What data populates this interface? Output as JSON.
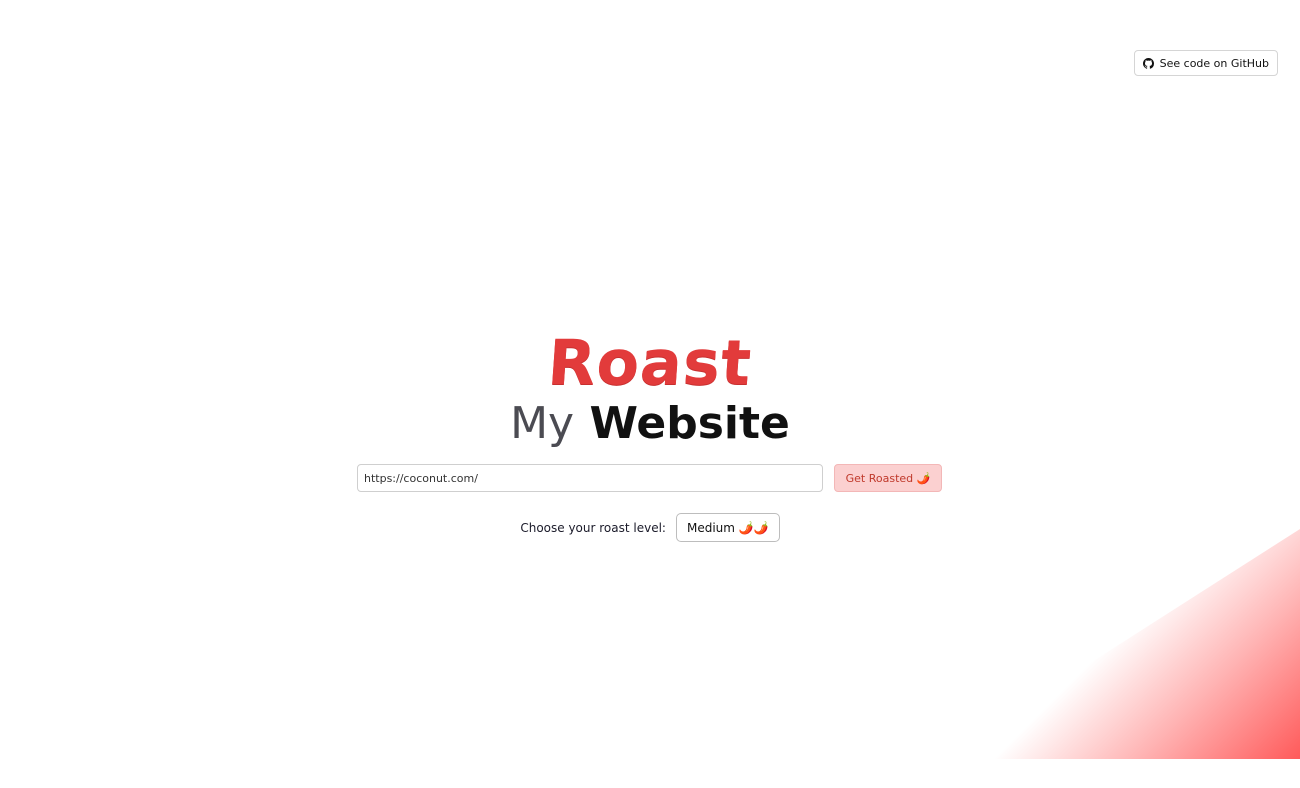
{
  "header": {
    "github_button_label": "See code on GitHub",
    "github_icon": "github-icon"
  },
  "title": {
    "line1": "Roast",
    "line2_word1": "My",
    "line2_word2": "Website"
  },
  "form": {
    "url_value": "https://coconut.com/",
    "submit_label": "Get Roasted 🌶️"
  },
  "roast_level": {
    "label": "Choose your roast level:",
    "selected": "Medium 🌶️🌶️"
  },
  "colors": {
    "accent_red": "#e23b3b",
    "button_bg": "#fbd0d0",
    "gradient_end": "#ff5a5a"
  }
}
